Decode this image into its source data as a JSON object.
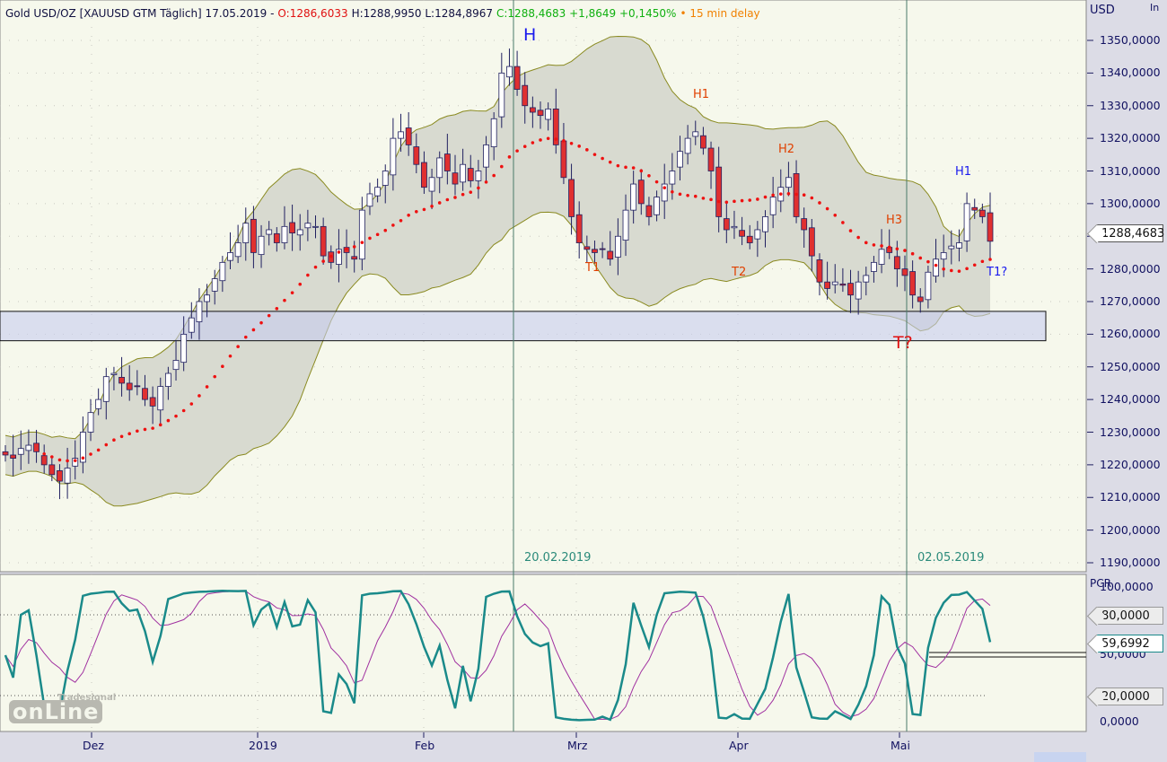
{
  "header": {
    "title": "Gold USD/OZ [XAUUSD GTM Täglich] 17.05.2019 -",
    "open": "O:1286,6033",
    "high_low": "H:1288,9950 L:1284,8967",
    "close_change": "C:1288,4683 +1,8649 +0,1450%",
    "delay": "• 15 min delay",
    "corner_label": "In"
  },
  "colors": {
    "up": "#ffffff",
    "down": "#e03030",
    "outline": "#202060",
    "ma": "#ee1111",
    "band": "#8a8a20",
    "pcr": "#1a8a8a",
    "signal": "#a030a0",
    "support": "#c8cdf0"
  },
  "logo": {
    "top": "Tradesignal",
    "main": "onLine"
  },
  "chart_data": [
    {
      "type": "candlestick",
      "title": "Gold USD/OZ [XAUUSD GTM Täglich]",
      "ylabel": "USD",
      "ylim": [
        1185,
        1362
      ],
      "y_ticks": [
        "1350,0000",
        "1340,0000",
        "1330,0000",
        "1320,0000",
        "1310,0000",
        "1300,0000",
        "1290,0000",
        "1280,0000",
        "1270,0000",
        "1260,0000",
        "1250,0000",
        "1240,0000",
        "1230,0000",
        "1220,0000",
        "1210,0000",
        "1200,0000",
        "1190,0000"
      ],
      "x_ticks": [
        "Dez",
        "2019",
        "Feb",
        "Mrz",
        "Apr",
        "Mai"
      ],
      "closes": [
        1223,
        1222,
        1225,
        1226,
        1224,
        1220,
        1217,
        1215,
        1219,
        1222,
        1230,
        1236,
        1240,
        1247,
        1248,
        1245,
        1243,
        1244,
        1240,
        1238,
        1244,
        1248,
        1252,
        1260,
        1265,
        1270,
        1272,
        1277,
        1282,
        1285,
        1288,
        1294,
        1285,
        1290,
        1292,
        1288,
        1293,
        1291,
        1292,
        1294,
        1293,
        1284,
        1282,
        1286,
        1285,
        1283,
        1298,
        1303,
        1305,
        1310,
        1320,
        1322,
        1318,
        1312,
        1305,
        1308,
        1314,
        1310,
        1306,
        1312,
        1307,
        1310,
        1318,
        1326,
        1340,
        1342,
        1335,
        1330,
        1328,
        1327,
        1329,
        1318,
        1308,
        1296,
        1288,
        1286,
        1285,
        1286,
        1283,
        1290,
        1298,
        1306,
        1300,
        1296,
        1302,
        1306,
        1310,
        1316,
        1320,
        1322,
        1317,
        1310,
        1296,
        1292,
        1293,
        1290,
        1288,
        1292,
        1296,
        1302,
        1305,
        1308,
        1296,
        1292,
        1284,
        1276,
        1274,
        1276,
        1275,
        1272,
        1276,
        1278,
        1282,
        1286,
        1285,
        1280,
        1278,
        1272,
        1270,
        1279,
        1283,
        1285,
        1287,
        1288,
        1300,
        1298,
        1296,
        1288.4683
      ],
      "indicators": [
        "Moving average 20 (red dots)",
        "Bollinger Bands 20, 2"
      ],
      "support_zone": [
        1258,
        1267
      ],
      "current_price": "1288,4683",
      "markers": [
        {
          "label": "20.02.2019"
        },
        {
          "label": "02.05.2019"
        }
      ],
      "annotations": [
        {
          "text": "H",
          "color": "#1a1aee"
        },
        {
          "text": "H1",
          "color": "#e04000"
        },
        {
          "text": "H2",
          "color": "#e04000"
        },
        {
          "text": "H3",
          "color": "#e04000"
        },
        {
          "text": "H1",
          "color": "#1a1aee"
        },
        {
          "text": "T1",
          "color": "#e04000"
        },
        {
          "text": "T2",
          "color": "#e04000"
        },
        {
          "text": "T1?",
          "color": "#1a1aee"
        },
        {
          "text": "T?",
          "color": "#e01010"
        }
      ]
    },
    {
      "type": "line",
      "title": "PCR",
      "ylim": [
        -5,
        105
      ],
      "y_ticks": [
        "100,0000",
        "50,0000",
        "0,0000"
      ],
      "levels": [
        80,
        20
      ],
      "tags": [
        "80,0000",
        "59,6992",
        "20,0000"
      ],
      "last_value": 59.6992
    }
  ]
}
